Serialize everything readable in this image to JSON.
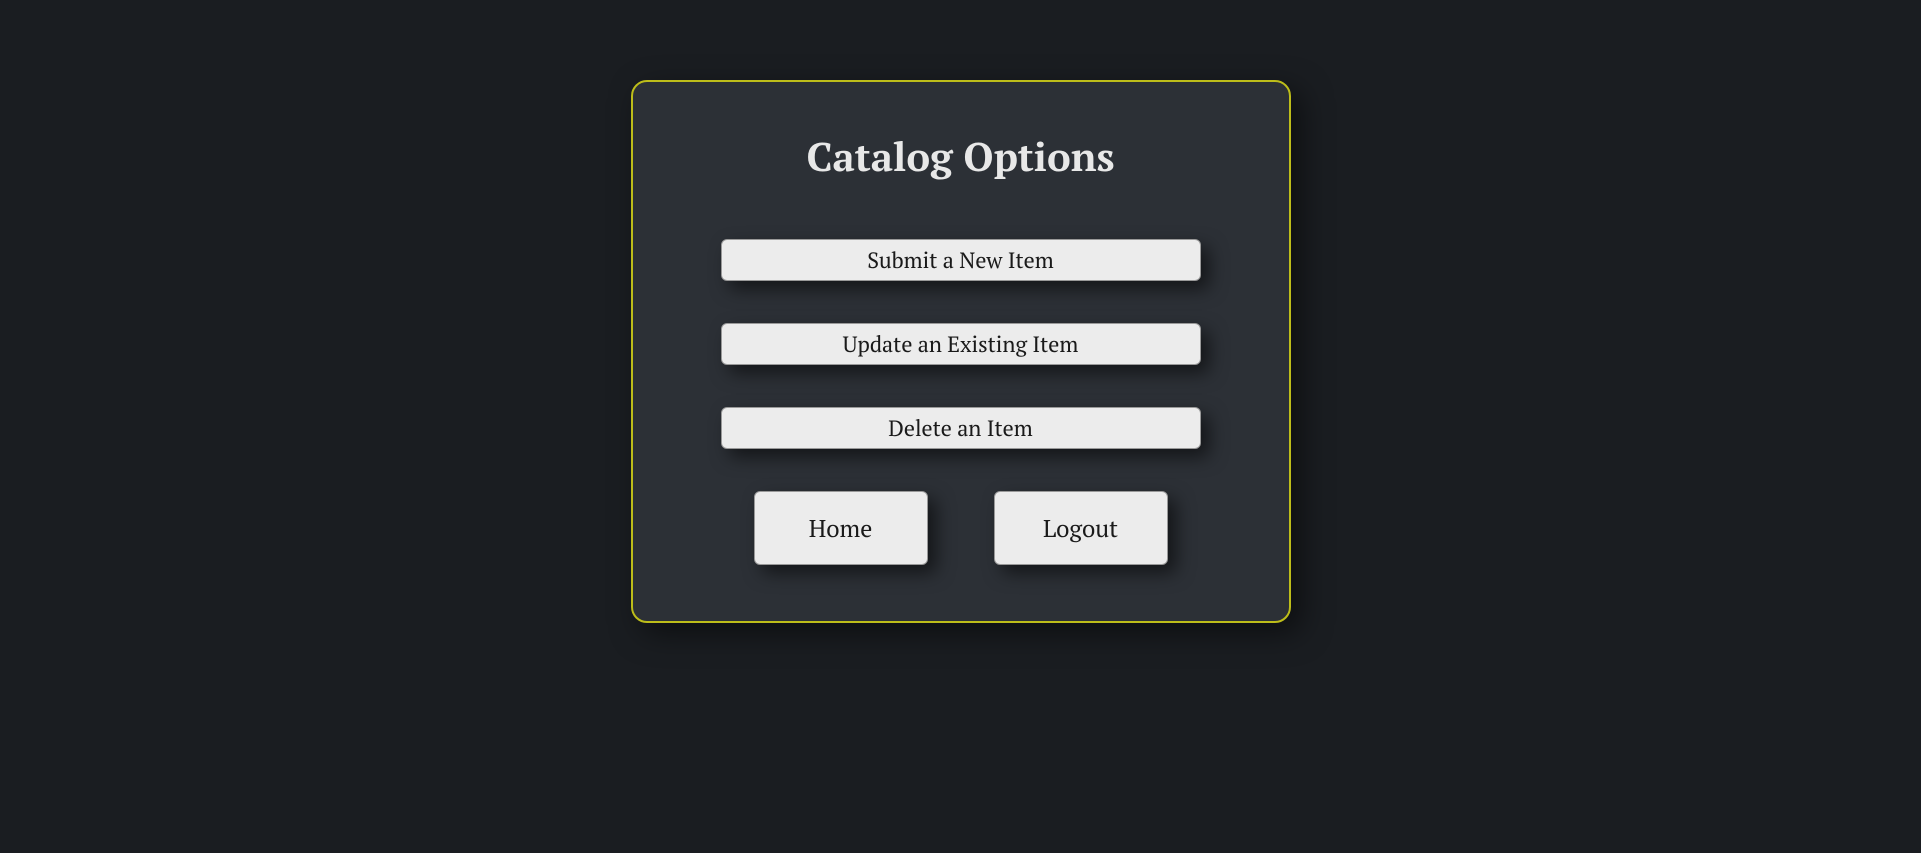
{
  "panel": {
    "title": "Catalog Options",
    "actions": {
      "submit": "Submit a New Item",
      "update": "Update an Existing Item",
      "delete": "Delete an Item"
    },
    "nav": {
      "home": "Home",
      "logout": "Logout"
    }
  }
}
